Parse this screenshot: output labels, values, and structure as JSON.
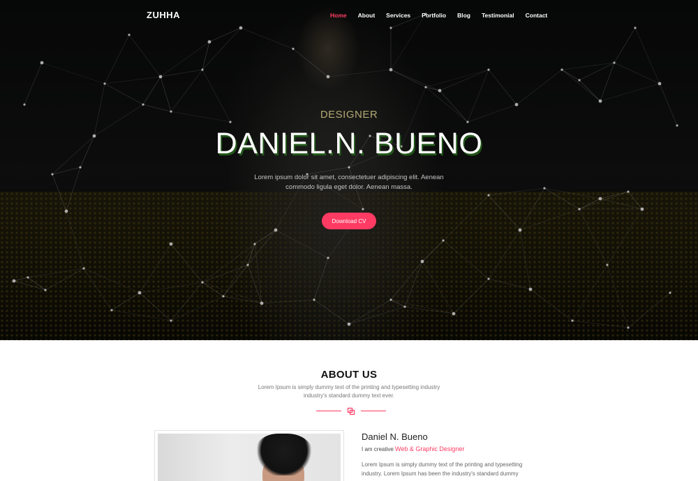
{
  "nav": {
    "logo": "ZUHHA",
    "items": [
      {
        "label": "Home",
        "active": true
      },
      {
        "label": "About"
      },
      {
        "label": "Services"
      },
      {
        "label": "Portfolio"
      },
      {
        "label": "Blog"
      },
      {
        "label": "Testimonial"
      },
      {
        "label": "Contact"
      }
    ]
  },
  "hero": {
    "subtitle": "DESIGNER",
    "title": "DANIEL.N. BUENO",
    "description": "Lorem ipsum dolor sit amet, consectetuer adipiscing elit. Aenean commodo ligula eget dolor. Aenean massa.",
    "cta_label": "Download CV"
  },
  "about": {
    "title": "ABOUT US",
    "description": "Lorem Ipsum is simply dummy text of the printing and typesetting industry industry's standard dummy text ever.",
    "name": "Daniel N. Bueno",
    "role_prefix": "I am creative",
    "role_highlight": "Web & Graphic Designer",
    "body": "Lorem Ipsum is simply dummy text of the printing and typesetting industry. Lorem Ipsum has been the industry's standard dummy"
  },
  "colors": {
    "accent": "#ff3b63",
    "subtitle": "#b3a974"
  }
}
